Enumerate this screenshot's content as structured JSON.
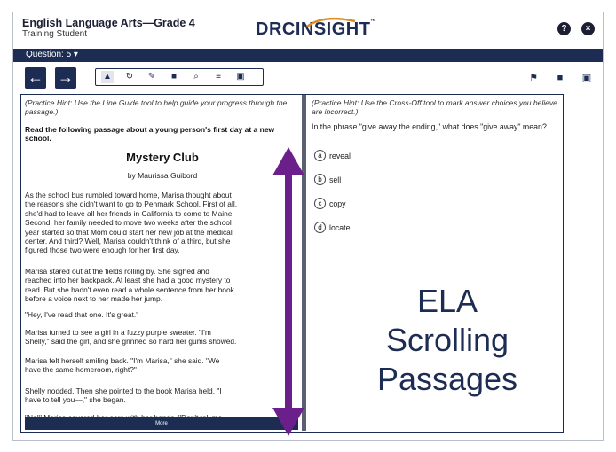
{
  "header": {
    "title": "English Language Arts—Grade 4",
    "user": "Training Student",
    "logo_left": "DRC",
    "logo_right": "INSIGHT",
    "logo_tm": "™",
    "help_label": "?",
    "close_label": "×"
  },
  "nav": {
    "question_label": "Question: 5 ▾"
  },
  "toolbar": {
    "back_label": "←",
    "forward_label": "→",
    "tools": [
      {
        "name": "pointer-tool",
        "icon": "▲"
      },
      {
        "name": "reread-tool",
        "icon": "↻"
      },
      {
        "name": "highlighter-tool",
        "icon": "✎"
      },
      {
        "name": "sticky-note-tool",
        "icon": "■"
      },
      {
        "name": "magnifier-tool",
        "icon": "⌕"
      },
      {
        "name": "line-guide-tool",
        "icon": "≡"
      },
      {
        "name": "calculator-tool",
        "icon": "▣"
      }
    ],
    "right_tools": [
      {
        "name": "flag-icon",
        "icon": "⚑"
      },
      {
        "name": "notepad-icon",
        "icon": "■"
      },
      {
        "name": "review-icon",
        "icon": "▣"
      }
    ]
  },
  "passage": {
    "hint": "(Practice Hint: Use the Line Guide tool to help guide your progress through the passage.)",
    "instructions": "Read the following passage about a young person's first day at a new school.",
    "title": "Mystery Club",
    "byline": "by Maurissa Guibord",
    "paragraphs": [
      "     As the school bus rumbled toward home, Marisa thought about\nthe reasons she didn't want to go to Penmark School. First of all,\nshe'd had to leave all her friends in California to come to Maine.\nSecond, her family needed to move two weeks after the school\nyear started so that Mom could start her new job at the medical\ncenter. And third? Well, Marisa couldn't think of a third, but she\nfigured those two were enough for her first day.",
      "     Marisa stared out at the fields rolling by. She sighed and\nreached into her backpack. At least she had a good mystery to\nread. But she hadn't even read a whole sentence from her book\nbefore a voice next to her made her jump.",
      "     \"Hey, I've read that one. It's great.\"",
      "     Marisa turned to see a girl in a fuzzy purple sweater. \"I'm\nShelly,\" said the girl, and she grinned so hard her gums showed.",
      "     Marisa felt herself smiling back. \"I'm Marisa,\" she said. \"We\nhave the same homeroom, right?\"",
      "     Shelly nodded. Then she pointed to the book Marisa held. \"I\nhave to tell you—,\" she began.",
      "     \"No!\" Marisa covered her ears with her hands. \"Don't tell me"
    ],
    "more_label": "More"
  },
  "question": {
    "hint": "(Practice Hint: Use the Cross-Off tool to mark answer choices you believe are incorrect.)",
    "stem": "In the phrase \"give away the ending,\" what does \"give away\" mean?",
    "choices": [
      {
        "letter": "a",
        "text": "reveal"
      },
      {
        "letter": "b",
        "text": "sell"
      },
      {
        "letter": "c",
        "text": "copy"
      },
      {
        "letter": "d",
        "text": "locate"
      }
    ]
  },
  "overlay": {
    "line1": "ELA",
    "line2": "Scrolling",
    "line3": "Passages",
    "color": "#1c2c53"
  },
  "arrow_color": "#6b1f8a"
}
